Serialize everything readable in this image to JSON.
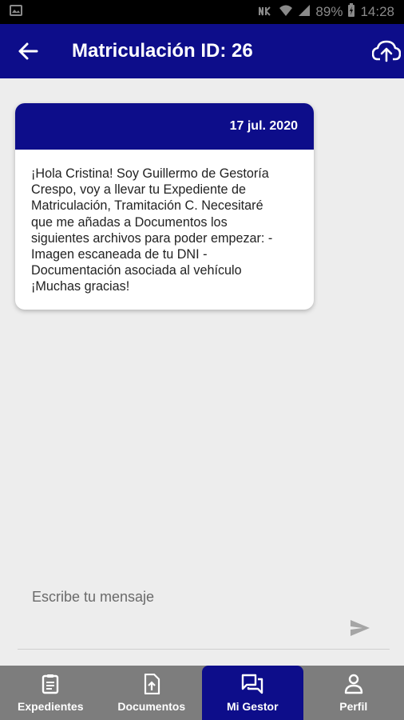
{
  "status_bar": {
    "battery": "89%",
    "time": "14:28"
  },
  "app_bar": {
    "title": "Matriculación ID: 26"
  },
  "message": {
    "date": "17 jul. 2020",
    "text": "¡Hola Cristina! Soy Guillermo de Gestoría\nCrespo, voy a llevar tu Expediente de\nMatriculación, Tramitación C. Necesitaré\nque me añadas a Documentos los\nsiguientes archivos para poder empezar: -\nImagen escaneada de tu DNI -\nDocumentación asociada al vehículo\n¡Muchas gracias!"
  },
  "composer": {
    "placeholder": "Escribe tu mensaje"
  },
  "bottom_nav": {
    "items": [
      {
        "label": "Expedientes",
        "icon": "clipboard-icon",
        "active": false
      },
      {
        "label": "Documentos",
        "icon": "document-upload-icon",
        "active": false
      },
      {
        "label": "Mi Gestor",
        "icon": "chat-icon",
        "active": true
      },
      {
        "label": "Perfil",
        "icon": "person-icon",
        "active": false
      }
    ]
  },
  "colors": {
    "primary": "#0d0d8a",
    "nav_background": "#7d7d7d",
    "page_background": "#ededed"
  }
}
